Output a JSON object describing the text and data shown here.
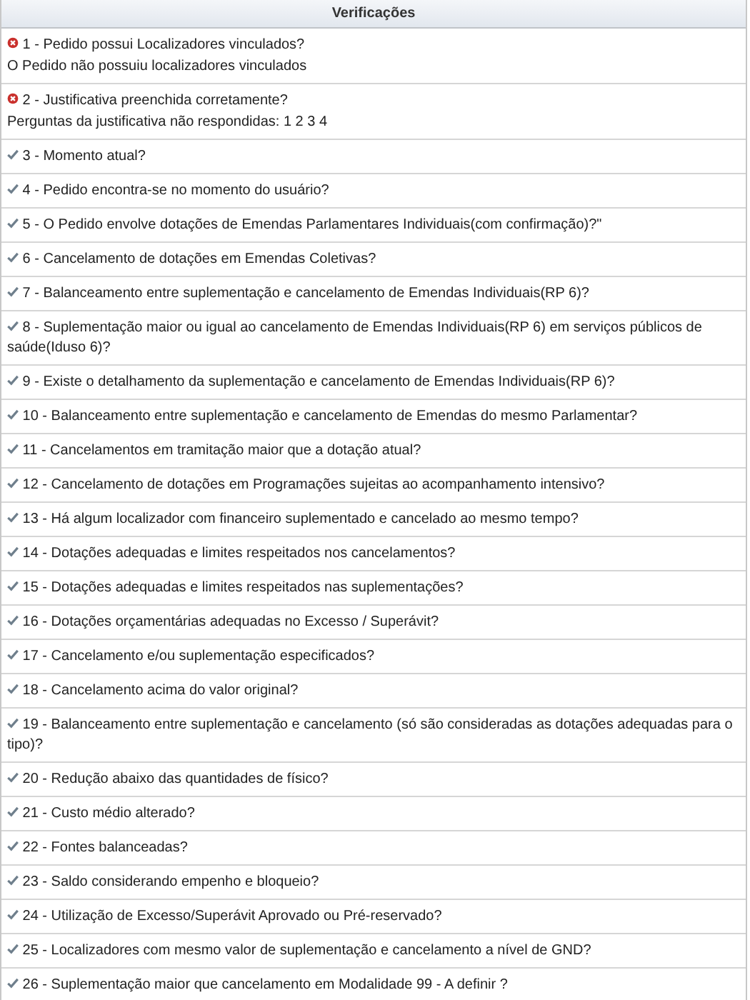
{
  "panel": {
    "title": "Verificações"
  },
  "checks": [
    {
      "kind": "fail",
      "label": "1 - Pedido possui Localizadores vinculados?",
      "detail": "O Pedido não possuiu localizadores vinculados"
    },
    {
      "kind": "fail",
      "label": "2 - Justificativa preenchida corretamente?",
      "detail": "Perguntas da justificativa não respondidas: 1 2 3 4"
    },
    {
      "kind": "pass",
      "label": "3 - Momento atual?"
    },
    {
      "kind": "pass",
      "label": "4 - Pedido encontra-se no momento do usuário?"
    },
    {
      "kind": "pass",
      "label": "5 - O Pedido envolve dotações de Emendas Parlamentares Individuais(com confirmação)?\""
    },
    {
      "kind": "pass",
      "label": "6 - Cancelamento de dotações em Emendas Coletivas?"
    },
    {
      "kind": "pass",
      "label": "7 - Balanceamento entre suplementação e cancelamento de Emendas Individuais(RP 6)?"
    },
    {
      "kind": "pass",
      "label": "8 - Suplementação maior ou igual ao cancelamento de Emendas Individuais(RP 6) em serviços públicos de saúde(Iduso 6)?"
    },
    {
      "kind": "pass",
      "label": "9 - Existe o detalhamento da suplementação e cancelamento de Emendas Individuais(RP 6)?"
    },
    {
      "kind": "pass",
      "label": "10 - Balanceamento entre suplementação e cancelamento de Emendas do mesmo Parlamentar?"
    },
    {
      "kind": "pass",
      "label": "11 - Cancelamentos em tramitação maior que a dotação atual?"
    },
    {
      "kind": "pass",
      "label": "12 - Cancelamento de dotações em Programações sujeitas ao acompanhamento intensivo?"
    },
    {
      "kind": "pass",
      "label": "13 - Há algum localizador com financeiro suplementado e cancelado ao mesmo tempo?"
    },
    {
      "kind": "pass",
      "label": "14 - Dotações adequadas e limites respeitados nos cancelamentos?"
    },
    {
      "kind": "pass",
      "label": "15 - Dotações adequadas e limites respeitados nas suplementações?"
    },
    {
      "kind": "pass",
      "label": "16 - Dotações orçamentárias adequadas no Excesso / Superávit?"
    },
    {
      "kind": "pass",
      "label": "17 - Cancelamento e/ou suplementação especificados?"
    },
    {
      "kind": "pass",
      "label": "18 - Cancelamento acima do valor original?"
    },
    {
      "kind": "pass",
      "label": "19 - Balanceamento entre suplementação e cancelamento (só são consideradas as dotações adequadas para o tipo)?"
    },
    {
      "kind": "pass",
      "label": "20 - Redução abaixo das quantidades de físico?"
    },
    {
      "kind": "pass",
      "label": "21 - Custo médio alterado?"
    },
    {
      "kind": "pass",
      "label": "22 - Fontes balanceadas?"
    },
    {
      "kind": "pass",
      "label": "23 - Saldo considerando empenho e bloqueio?"
    },
    {
      "kind": "pass",
      "label": "24 - Utilização de Excesso/Superávit Aprovado ou Pré-reservado?"
    },
    {
      "kind": "pass",
      "label": "25 - Localizadores com mesmo valor de suplementação e cancelamento a nível de GND?"
    },
    {
      "kind": "pass",
      "label": "26 - Suplementação maior que cancelamento em Modalidade 99 - A definir ?"
    }
  ]
}
